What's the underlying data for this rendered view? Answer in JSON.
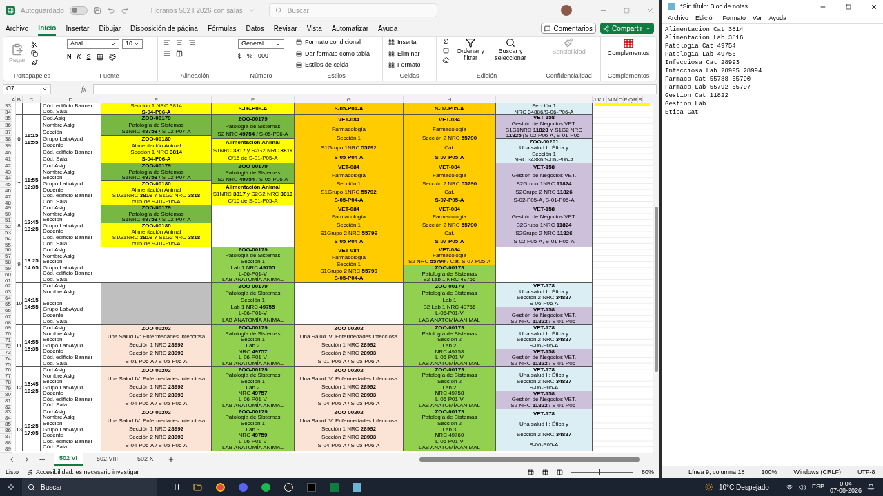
{
  "excel": {
    "autosave": {
      "label": "Autoguardado",
      "on": false
    },
    "title": "Horarios 502 I 2026 con salas",
    "search_placeholder": "Buscar",
    "menu": [
      {
        "label": "Archivo",
        "selected": false
      },
      {
        "label": "Inicio",
        "selected": true
      },
      {
        "label": "Insertar",
        "selected": false
      },
      {
        "label": "Dibujar",
        "selected": false
      },
      {
        "label": "Disposición de página",
        "selected": false
      },
      {
        "label": "Fórmulas",
        "selected": false
      },
      {
        "label": "Datos",
        "selected": false
      },
      {
        "label": "Revisar",
        "selected": false
      },
      {
        "label": "Vista",
        "selected": false
      },
      {
        "label": "Automatizar",
        "selected": false
      },
      {
        "label": "Ayuda",
        "selected": false
      }
    ],
    "comments_button": "Comentarios",
    "share_button": "Compartir",
    "ribbon": {
      "clipboard": {
        "title": "Portapapeles",
        "paste": "Pegar"
      },
      "font": {
        "title": "Fuente",
        "family": "Arial",
        "size": "10",
        "bold": "N",
        "italic": "K",
        "underline": "S"
      },
      "alignment": {
        "title": "Alineación"
      },
      "number": {
        "title": "Número",
        "format": "General",
        "currency": "$",
        "percent": "%",
        "thousands": "000"
      },
      "styles": {
        "title": "Estilos",
        "items": [
          "Formato condicional",
          "Dar formato como tabla",
          "Estilos de celda"
        ]
      },
      "cells": {
        "title": "Celdas",
        "items": [
          "Insertar",
          "Eliminar",
          "Formato"
        ]
      },
      "editing": {
        "title": "Edición",
        "sort": "Ordenar y filtrar",
        "find": "Buscar y seleccionar"
      },
      "sensitivity": {
        "title": "Confidencialidad",
        "label": "Sensibilidad",
        "disabled": true
      },
      "addins": {
        "title": "Complementos",
        "label": "Complementos"
      }
    },
    "name_box": "O7",
    "formula_label": "fx",
    "columns": [
      "A",
      "B",
      "C",
      "D",
      "E",
      "F",
      "G",
      "H",
      "I",
      "J",
      "K",
      "L",
      "M",
      "N",
      "O",
      "P",
      "Q",
      "R",
      "S"
    ],
    "blocks": [
      {
        "rows": [
          {
            "number": "33",
            "label": "Cód. edificio Banner"
          },
          {
            "number": "34",
            "label": "Cód. Sala"
          }
        ],
        "columns": [
          [
            {
              "color": "#ffff00",
              "lines": [
                "Sección 1 NRC 3814",
                "**S-04-P06-A**"
              ]
            }
          ],
          [
            {
              "color": "#ffff00",
              "lines": [
                "**S-06-P06-A**"
              ]
            }
          ],
          [
            {
              "color": "#ffcc00",
              "lines": [
                "**S-05-P04-A**"
              ]
            }
          ],
          [
            {
              "color": "#ffcc00",
              "lines": [
                "**S-07-P05-A**"
              ]
            }
          ],
          [
            {
              "color": "#daeef3",
              "lines": [
                "Sección 1",
                "NRC 34886/S-06-P06-A"
              ]
            }
          ]
        ]
      },
      {
        "number": "6",
        "start": "11:15",
        "end": "11:55",
        "rows": [
          {
            "number": "35",
            "label": "Cod.Asig"
          },
          {
            "number": "36",
            "label": "Nombre Asig"
          },
          {
            "number": "37",
            "label": "Sección"
          },
          {
            "number": "38",
            "label": "Grupo Lab/Ayud"
          },
          {
            "number": "39",
            "label": "Docente"
          },
          {
            "number": "40",
            "label": "Cód. edificio Banner"
          },
          {
            "number": "41",
            "label": "Cód. Sala"
          }
        ],
        "columns": [
          [
            {
              "color": "#77b843",
              "lines": [
                "**ZOO-00179**",
                "Patología de Sistemas",
                "S1NRC **49753** / S-02-P07-A"
              ]
            },
            {
              "color": "#ffff00",
              "lines": [
                "**ZOO-00180**",
                "Alimentación Animal",
                "Sección 1 NRC **3814**",
                "**S-04-P06-A**"
              ]
            }
          ],
          [
            {
              "color": "#77b843",
              "lines": [
                "**ZOO-00179**",
                "Patología de Sistemas",
                "S2 NRC **49754** / S-05-P06-A"
              ]
            },
            {
              "color": "#ffff00",
              "lines": [
                "**Alimentación Animal**",
                "S1NRC **3817** y S2G2 NRC **3819**",
                "C/15 de S-01-P05-A"
              ]
            }
          ],
          [
            {
              "color": "#ffcc00",
              "lines": [
                "**VET-084**",
                "Farmacología",
                "Sección 1",
                "S1Grupo 1NRC **55792**",
                "**S-05-P04-A**"
              ]
            }
          ],
          [
            {
              "color": "#ffcc00",
              "lines": [
                "**VET-084**",
                "Farmacología",
                "Sección 2 NRC **55790**",
                "Cat.",
                "**S-07-P05-A**"
              ]
            }
          ],
          [
            {
              "color": "#ccc0da",
              "lines": [
                "**VET-158**",
                "Gestión de Negocios VET.",
                "S1G1NRC **11823** Y S1G2 NRC",
                "**11825** (S-02-P06-A, S-01-P06-"
              ]
            },
            {
              "color": "#daeef3",
              "lines": [
                "**ZOO-00201**",
                "Una salud II: Ética y",
                "Sección 1",
                "NRC 34886/S-06-P06-A"
              ]
            }
          ]
        ]
      },
      {
        "number": "7",
        "start": "11:55",
        "end": "12:35",
        "rows": [
          {
            "number": "42",
            "label": "Cod.Asig"
          },
          {
            "number": "43",
            "label": "Nombre Asig"
          },
          {
            "number": "44",
            "label": "Sección"
          },
          {
            "number": "45",
            "label": "Grupo Lab/Ayud"
          },
          {
            "number": "46",
            "label": "Docente"
          },
          {
            "number": "47",
            "label": "Cód. edificio Banner"
          },
          {
            "number": "48",
            "label": "Cód. Sala"
          }
        ],
        "columns": [
          [
            {
              "color": "#77b843",
              "lines": [
                "**ZOO-00179**",
                "Patología de Sistemas",
                "S1NRC **49753** / S-02-P07-A"
              ]
            },
            {
              "color": "#ffff00",
              "lines": [
                "**ZOO-00180**",
                "Alimentación Animal",
                "S1G1NRC **3816** Y S1G2 NRC **3818**",
                "c/15 de S-01-P05-A"
              ]
            }
          ],
          [
            {
              "color": "#77b843",
              "lines": [
                "**ZOO-00179**",
                "Patología de Sistemas",
                "S2 NRC **49754** / S-05-P06-A"
              ]
            },
            {
              "color": "#ffff00",
              "lines": [
                "**Alimentación Animal**",
                "S1NRC **3817** y S2G2 NRC **3819**",
                "C/15 de S-01-P05-A"
              ]
            }
          ],
          [
            {
              "color": "#ffcc00",
              "lines": [
                "**VET-084**",
                "Farmacología",
                "Sección 1",
                "S1Grupo 1NRC **55792**",
                "**S-05-P04-A**"
              ]
            }
          ],
          [
            {
              "color": "#ffcc00",
              "lines": [
                "**VET-084**",
                "Farmacología",
                "Sección 2 NRC **55790**",
                "Cat.",
                "**S-07-P05-A**"
              ]
            }
          ],
          [
            {
              "color": "#ccc0da",
              "lines": [
                "**VET-158**",
                "Gestión de Negocios VET.",
                "S2Grupo 1NRC **11824**",
                "S2Grupo 2 NRC **11826**",
                "S-02-P05-A, S-01-P05-A"
              ]
            }
          ]
        ]
      },
      {
        "number": "8",
        "start": "12:45",
        "end": "13:25",
        "rows": [
          {
            "number": "49",
            "label": "Cod.Asig"
          },
          {
            "number": "50",
            "label": "Nombre Asig"
          },
          {
            "number": "51",
            "label": "Sección"
          },
          {
            "number": "52",
            "label": "Grupo Lab/Ayud"
          },
          {
            "number": "53",
            "label": "Docente"
          },
          {
            "number": "54",
            "label": "Cód. edificio Banner"
          },
          {
            "number": "55",
            "label": "Cód. Sala"
          }
        ],
        "columns": [
          [
            {
              "color": "#77b843",
              "lines": [
                "**ZOO-00179**",
                "Patología de Sistemas",
                "S1NRC **49753** / S-02-P07-A"
              ]
            },
            {
              "color": "#ffff00",
              "lines": [
                "**ZOO-00180**",
                "Alimentación Animal",
                "S1G1NRC **3816** Y S1G2 NRC **3818**",
                "c/15 de S-01-P05-A"
              ]
            }
          ],
          [
            {
              "color": "#ffffff"
            }
          ],
          [
            {
              "color": "#ffcc00",
              "lines": [
                "**VET-084**",
                "Farmacología",
                "Sección 1",
                "S1Grupo 2 NRC **55796**",
                "**S-05-P04-A**"
              ]
            }
          ],
          [
            {
              "color": "#ffcc00",
              "lines": [
                "**VET-084**",
                "Farmacología",
                "Sección 2 NRC **55790**",
                "Cat.",
                "**S-07-P05-A**"
              ]
            }
          ],
          [
            {
              "color": "#ccc0da",
              "lines": [
                "**VET-158**",
                "Gestión de Negocios VET.",
                "S2Grupo 1NRC **11824**",
                "S2Grupo 2 NRC **11826**",
                "S-02-P05-A, S-01-P05-A"
              ]
            }
          ]
        ]
      },
      {
        "number": "9",
        "start": "13:25",
        "end": "14:05",
        "rows": [
          {
            "number": "56",
            "label": "Cod.Asig"
          },
          {
            "number": "57",
            "label": "Nombre Asig"
          },
          {
            "number": "58",
            "label": "Sección"
          },
          {
            "number": "59",
            "label": "Grupo Lab/Ayud"
          },
          {
            "number": "60",
            "label": "Cód. edificio Banner"
          },
          {
            "number": "61",
            "label": "Cód. Sala"
          }
        ],
        "columns": [
          [
            {
              "color": "#ffffff"
            }
          ],
          [
            {
              "color": "#92d050",
              "lines": [
                "**ZOO-00179**",
                "Patología de Sistemas",
                "Sección 1",
                "Lab 1 NRC **49755**",
                "L-06-P01-V",
                "LAB ANATOMÍA ANIMAL"
              ]
            }
          ],
          [
            {
              "color": "#ffcc00",
              "lines": [
                "**VET-084**",
                "Farmacología",
                "Sección 1",
                "S1Grupo 2 NRC **55796**",
                "**S-05-P04-A**"
              ]
            }
          ],
          [
            {
              "color": "#ffcc00",
              "lines": [
                "**VET-084**",
                "Farmacología",
                "S2 NRC **55790** / Cat. S-07-P05-A"
              ]
            },
            {
              "color": "#92d050",
              "lines": [
                "**ZOO-00179**",
                "Patología de Sistemas",
                "S2 Lab 1 NRC 49756"
              ]
            }
          ],
          [
            {
              "color": "#ffffff"
            }
          ]
        ]
      },
      {
        "number": "10",
        "start": "14:15",
        "end": "14:55",
        "rows": [
          {
            "number": "62",
            "label": "Cod.Asig"
          },
          {
            "number": "63",
            "label": "Nombre Asig"
          },
          {
            "number": "64"
          },
          {
            "number": "65",
            "label": "Sección"
          },
          {
            "number": "66",
            "label": "Grupo Lab/Ayud"
          },
          {
            "number": "67",
            "label": "Docente"
          },
          {
            "number": "68",
            "label": "Cód. Sala"
          }
        ],
        "columns": [
          [
            {
              "color": "#bfbfbf"
            }
          ],
          [
            {
              "color": "#92d050",
              "lines": [
                "**ZOO-00179**",
                "Patología de Sistemas",
                "Sección 1",
                "Lab 1 NRC **49755**",
                "L-06-P01-V",
                "LAB ANATOMÍA ANIMAL"
              ]
            }
          ],
          [
            {
              "color": "#ffffff"
            }
          ],
          [
            {
              "color": "#92d050",
              "lines": [
                "**ZOO-00179**",
                "Patología de Sistemas",
                "Lab 1",
                "S2 Lab 1 NRC 49756",
                "L-06-P01-V",
                "LAB ANATOMÍA ANIMAL"
              ]
            }
          ],
          [
            {
              "color": "#daeef3",
              "lines": [
                "**VET-178**",
                "Una salud II: Ética y",
                "Sección 2 NRC **34887**",
                "S-06-P06-A"
              ]
            },
            {
              "color": "#ccc0da",
              "lines": [
                "**VET-158**",
                "Gestión de Negocios VET.",
                "S2 NRC **11822** / S-01-P06-"
              ]
            }
          ]
        ]
      },
      {
        "number": "11",
        "start": "14:55",
        "end": "15:35",
        "rows": [
          {
            "number": "69",
            "label": "Cod.Asig"
          },
          {
            "number": "70",
            "label": "Nombre Asig"
          },
          {
            "number": "71",
            "label": "Sección"
          },
          {
            "number": "72",
            "label": "Grupo Lab/Ayud"
          },
          {
            "number": "73",
            "label": "Docente"
          },
          {
            "number": "74",
            "label": "Cód. edificio Banner"
          },
          {
            "number": "75",
            "label": "Cód. Sala"
          }
        ],
        "columns": [
          [
            {
              "color": "#fbe4d5",
              "lines": [
                "**ZOO-00202**",
                "Una Salud IV: Enfermedades Infecciosa",
                "Sección 1 NRC **28992**",
                "Sección 2 NRC **28993**",
                "S-01-P06-A / S-05-P06-A"
              ]
            }
          ],
          [
            {
              "color": "#92d050",
              "lines": [
                "**ZOO-00179**",
                "Patología de Sistemas",
                "Sección 1",
                "Lab 2",
                "NRC **49757**",
                "L-06-P01-V",
                "LAB ANATOMÍA ANIMAL"
              ]
            }
          ],
          [
            {
              "color": "#fbe4d5",
              "lines": [
                "**ZOO-00202**",
                "Una Salud IV: Enfermedades Infecciosa",
                "Sección 1 NRC **28992**",
                "Sección 2 NRC **28993**",
                "S-01-P06-A / S-05-P06-A"
              ]
            }
          ],
          [
            {
              "color": "#92d050",
              "lines": [
                "**ZOO-00179**",
                "Patología de Sistemas",
                "Sección 2",
                "Lab 2",
                "NRC 49758",
                "L-06-P01-V",
                "LAB ANATOMÍA ANIMAL"
              ]
            }
          ],
          [
            {
              "color": "#daeef3",
              "lines": [
                "**VET-178**",
                "Una salud II: Ética y",
                "Sección 2 NRC **34887**",
                "S-06-P06-A"
              ]
            },
            {
              "color": "#ccc0da",
              "lines": [
                "**VET-158**",
                "Gestión de Negocios VET.",
                "S2 NRC **11822** / S-01-P06-"
              ]
            }
          ]
        ]
      },
      {
        "number": "12",
        "start": "15:45",
        "end": "16:25",
        "rows": [
          {
            "number": "76",
            "label": "Cod.Asig"
          },
          {
            "number": "77",
            "label": "Nombre Asig"
          },
          {
            "number": "78",
            "label": "Sección"
          },
          {
            "number": "79",
            "label": "Grupo Lab/Ayud"
          },
          {
            "number": "80",
            "label": "Docente"
          },
          {
            "number": "81",
            "label": "Cód. edificio Banner"
          },
          {
            "number": "82",
            "label": "Cód. Sala"
          }
        ],
        "columns": [
          [
            {
              "color": "#fbe4d5",
              "lines": [
                "**ZOO-00202**",
                "Una Salud IV: Enfermedades Infecciosa",
                "Sección 1 NRC **28992**",
                "Sección 2 NRC **28993**",
                "S-04-P06-A / S-05-P06-A"
              ]
            }
          ],
          [
            {
              "color": "#92d050",
              "lines": [
                "**ZOO-00179**",
                "Patología de Sistemas",
                "Sección 1",
                "Lab 2",
                "NRC **49757**",
                "L-06-P01-V",
                "LAB ANATOMÍA ANIMAL"
              ]
            }
          ],
          [
            {
              "color": "#fbe4d5",
              "lines": [
                "**ZOO-00202**",
                "Una Salud IV: Enfermedades Infecciosa",
                "Sección 1 NRC **28992**",
                "Sección 2 NRC **28993**",
                "S-04-P06-A / S-05-P06-A"
              ]
            }
          ],
          [
            {
              "color": "#92d050",
              "lines": [
                "**ZOO-00179**",
                "Patología de Sistemas",
                "Sección 2",
                "Lab 2",
                "NRC 49758",
                "L-06-P01-V",
                "LAB ANATOMÍA ANIMAL"
              ]
            }
          ],
          [
            {
              "color": "#daeef3",
              "lines": [
                "**VET-178**",
                "Una salud II: Ética y",
                "Sección 2 NRC **34887**",
                "S-06-P06-A"
              ]
            },
            {
              "color": "#ccc0da",
              "lines": [
                "**VET-158**",
                "Gestión de Negocios VET.",
                "S2 NRC **11822** / S-01-P06-"
              ]
            }
          ]
        ]
      },
      {
        "number": "13",
        "start": "16:25",
        "end": "17:05",
        "rows": [
          {
            "number": "83",
            "label": "Cod.Asig"
          },
          {
            "number": "84",
            "label": "Nombre Asig"
          },
          {
            "number": "85",
            "label": "Sección"
          },
          {
            "number": "86",
            "label": "Grupo Lab/Ayud"
          },
          {
            "number": "87",
            "label": "Docente"
          },
          {
            "number": "88",
            "label": "Cód. edificio Banner"
          },
          {
            "number": "89",
            "label": "Cód. Sala"
          }
        ],
        "columns": [
          [
            {
              "color": "#fbe4d5",
              "lines": [
                "**ZOO-00202**",
                "Una Salud IV: Enfermedades Infecciosa",
                "Sección 1 NRC **28992**",
                "Sección 2 NRC **28993**",
                "S-04-P06-A / S-05-P06-A"
              ]
            }
          ],
          [
            {
              "color": "#92d050",
              "lines": [
                "**ZOO-00179**",
                "Patología de Sistemas",
                "Sección 1",
                "Lab 3",
                "NRC **49759**",
                "L-06-P01-V",
                "LAB ANATOMÍA ANIMAL"
              ]
            }
          ],
          [
            {
              "color": "#fbe4d5",
              "lines": [
                "**ZOO-00202**",
                "Una Salud IV: Enfermedades Infecciosa",
                "Sección 1 NRC **28992**",
                "Sección 2 NRC **28993**",
                "S-04-P06-A / S-05-P06-A"
              ]
            }
          ],
          [
            {
              "color": "#92d050",
              "lines": [
                "**ZOO-00179**",
                "Patología de Sistemas",
                "Sección 2",
                "Lab 3",
                "NRC 49760",
                "L-06-P01-V",
                "LAB ANATOMÍA ANIMAL"
              ]
            }
          ],
          [
            {
              "color": "#daeef3",
              "lines": [
                "**VET-178**",
                "Una salud II: Ética y",
                "Sección 2 NRC **34887**",
                "S-06-P05-A"
              ]
            }
          ]
        ]
      }
    ],
    "sheet_tabs": [
      {
        "label": "502 VI",
        "selected": true
      },
      {
        "label": "502 VIII",
        "selected": false
      },
      {
        "label": "502 X",
        "selected": false
      }
    ],
    "status": {
      "ready": "Listo",
      "accessibility": "Accesibilidad: es necesario investigar",
      "zoom_slider": {
        "level": 0.45
      },
      "zoom": "80%"
    }
  },
  "notepad": {
    "title": "*Sin título: Bloc de notas",
    "menu": [
      "Archivo",
      "Edición",
      "Formato",
      "Ver",
      "Ayuda"
    ],
    "lines": [
      "Alimentacion Cat 3814",
      "Alimentacion Lab 3816",
      "Patologia Cat 49754",
      "Patologia Lab 49756",
      "Infecciosa Cat 28993",
      "Infecciosa Lab 28995 28994",
      "Farmaco Cat 55788 55790",
      "Farmaco Lab 55792 55797",
      "Gestion Cat 11822",
      "Gestion Lab",
      "Etica Cat"
    ],
    "status": [
      "Línea 9, columna 18",
      "100%",
      "Windows (CRLF)",
      "UTF-8"
    ]
  },
  "taskbar": {
    "search": "Buscar",
    "weather": "10°C Despejado",
    "language": "ESP",
    "time": "0:04",
    "date": "07-08-2026"
  }
}
